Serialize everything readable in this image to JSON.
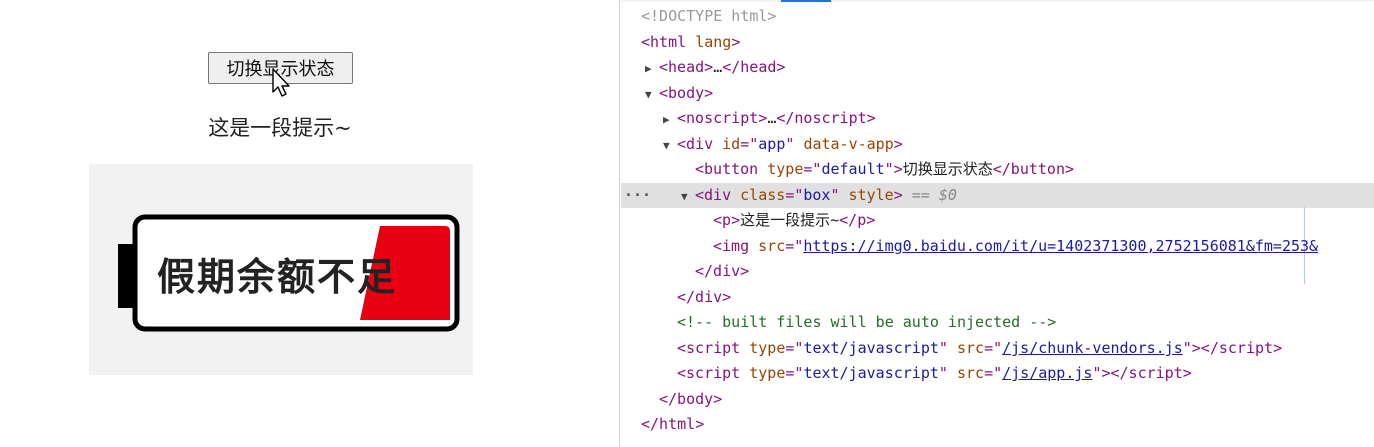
{
  "preview": {
    "button_label": "切换显示状态",
    "hint_text": "这是一段提示~",
    "image": {
      "text": "假期余额不足",
      "accent_color": "#e60012"
    }
  },
  "devtools": {
    "lines": {
      "doctype": "<!DOCTYPE html>",
      "html_open": "html",
      "html_lang": "lang",
      "head": "head",
      "head_close": "/head",
      "body": "body",
      "noscript": "noscript",
      "noscript_close": "/noscript",
      "div_app": "div",
      "div_app_id_name": "id",
      "div_app_id_val": "app",
      "div_app_dataattr": "data-v-app",
      "button_tag": "button",
      "button_type_name": "type",
      "button_type_val": "default",
      "button_text": "切换显示状态",
      "button_close": "/button",
      "div_box_tag": "div",
      "div_box_class_name": "class",
      "div_box_class_val": "box",
      "div_box_style_name": "style",
      "selected_suffix": "== $0",
      "p_tag": "p",
      "p_text": "这是一段提示~",
      "p_close": "/p",
      "img_tag": "img",
      "img_src_name": "src",
      "img_src_val": "https://img0.baidu.com/it/u=1402371300,2752156081&fm=253&",
      "div_close": "/div",
      "div_close2": "/div",
      "comment": "<!-- built files will be auto injected -->",
      "script1_tag": "script",
      "script1_type_name": "type",
      "script1_type_val": "text/javascript",
      "script1_src_name": "src",
      "script1_src_val": "/js/chunk-vendors.js",
      "script1_close": "/script",
      "script2_tag": "script",
      "script2_type_name": "type",
      "script2_type_val": "text/javascript",
      "script2_src_name": "src",
      "script2_src_val": "/js/app.js",
      "script2_close": "/script",
      "body_close": "/body",
      "html_close": "/html",
      "ellipsis": "…",
      "row_menu": "···"
    }
  }
}
